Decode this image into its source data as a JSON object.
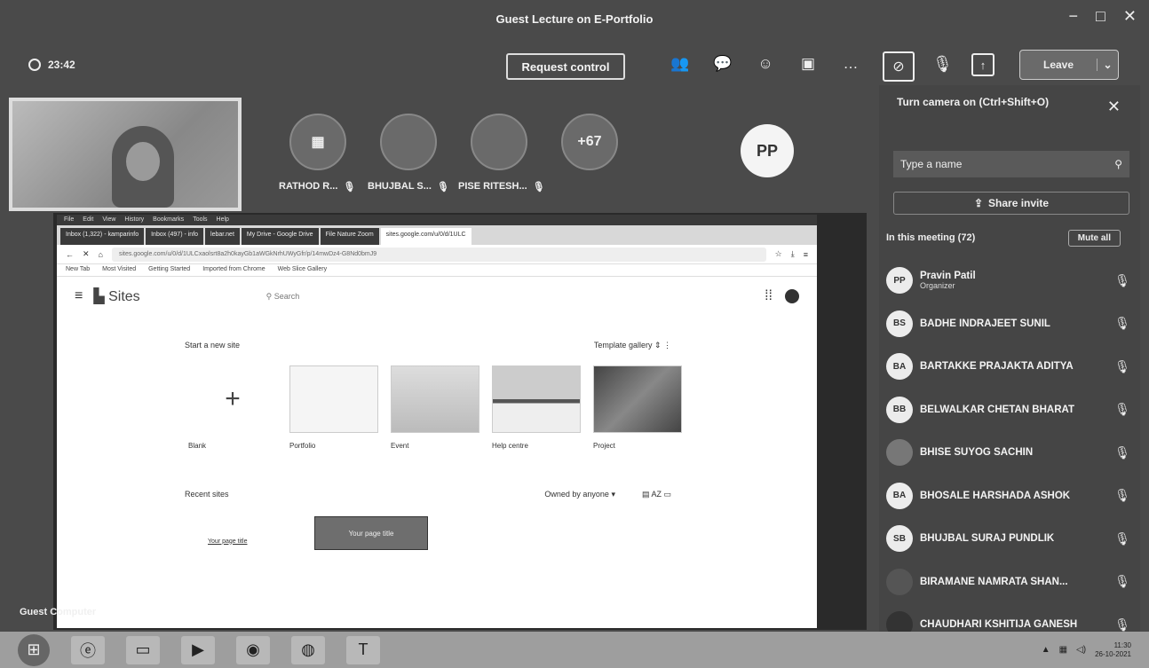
{
  "window": {
    "title": "Guest Lecture on E-Portfolio",
    "min_icon": "−",
    "max_icon": "□",
    "close_icon": "✕"
  },
  "toolbar": {
    "timer": "23:42",
    "request_control": "Request control",
    "leave_label": "Leave",
    "more_label": "…"
  },
  "participants": [
    {
      "initials": "▦",
      "label": "RATHOD R..."
    },
    {
      "initials": "",
      "label": "BHUJBAL S..."
    },
    {
      "initials": "",
      "label": "PISE RITESH..."
    },
    {
      "initials": "+67",
      "label": ""
    }
  ],
  "presenter_avatar": "PP",
  "guest_label": "Guest Computer",
  "browser": {
    "menu": [
      "File",
      "Edit",
      "View",
      "History",
      "Bookmarks",
      "Tools",
      "Help"
    ],
    "tabs": [
      "Inbox (1,322) - kamparinfo",
      "Inbox (497) - info",
      "lebar.net",
      "My Drive - Google Drive",
      "File Nature Zoom",
      "sites.google.com/u/0/d/1ULC"
    ],
    "address": "sites.google.com/u/0/d/1ULCxaolsrt8a2h0kayGb1aWGkNrhUWyGfr/p/14mwDz4-G8Nd0bmJ9",
    "bookmarks": [
      "New Tab",
      "Most Visited",
      "Getting Started",
      "Imported from Chrome",
      "Web Slice Gallery"
    ],
    "sites_title": "Sites",
    "search_placeholder": "Search",
    "start_label": "Start a new site",
    "template_gallery": "Template gallery",
    "templates": [
      {
        "name": "Blank"
      },
      {
        "name": "Portfolio"
      },
      {
        "name": "Event"
      },
      {
        "name": "Help centre"
      },
      {
        "name": "Project"
      }
    ],
    "recent_label": "Recent sites",
    "owned_by": "Owned by anyone",
    "recent_sites": [
      {
        "name": "Your page title"
      },
      {
        "name": "Your page title"
      }
    ]
  },
  "panel": {
    "camera_tooltip": "Turn camera on (Ctrl+Shift+O)",
    "name_placeholder": "Type a name",
    "share_invite": "Share invite",
    "in_meeting": "In this meeting (72)",
    "mute_all": "Mute all",
    "people": [
      {
        "initials": "PP",
        "name": "Pravin Patil",
        "role": "Organizer"
      },
      {
        "initials": "BS",
        "name": "BADHE INDRAJEET SUNIL",
        "role": ""
      },
      {
        "initials": "BA",
        "name": "BARTAKKE PRAJAKTA ADITYA",
        "role": ""
      },
      {
        "initials": "BB",
        "name": "BELWALKAR CHETAN BHARAT",
        "role": ""
      },
      {
        "initials": "",
        "name": "BHISE SUYOG SACHIN",
        "role": ""
      },
      {
        "initials": "BA",
        "name": "BHOSALE HARSHADA ASHOK",
        "role": ""
      },
      {
        "initials": "SB",
        "name": "BHUJBAL SURAJ PUNDLIK",
        "role": ""
      },
      {
        "initials": "",
        "name": "BIRAMANE NAMRATA SHAN...",
        "role": ""
      },
      {
        "initials": "",
        "name": "CHAUDHARI KSHITIJA GANESH",
        "role": ""
      }
    ]
  },
  "taskbar": {
    "clock_time": "11:30",
    "clock_date": "26-10-2021"
  }
}
